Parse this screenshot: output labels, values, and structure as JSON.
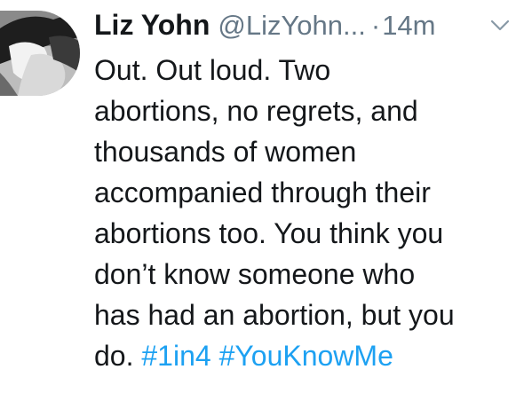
{
  "tweet": {
    "display_name": "Liz Yohn",
    "handle": "@LizYohn...",
    "separator": "·",
    "time": "14m",
    "menu_icon": "chevron-down-icon",
    "avatar_icon": "profile-photo",
    "text_lines": [
      "Out. Out loud. Two",
      "abortions, no regrets, and",
      "thousands of women",
      "accompanied through their",
      "abortions too. You think you",
      "don’t know someone who",
      "has had an abortion, but you"
    ],
    "last_line_text": "do. ",
    "hashtags": [
      "#1in4",
      "#YouKnowMe"
    ],
    "colors": {
      "text": "#14171a",
      "secondary": "#657786",
      "link": "#1da1f2"
    }
  }
}
